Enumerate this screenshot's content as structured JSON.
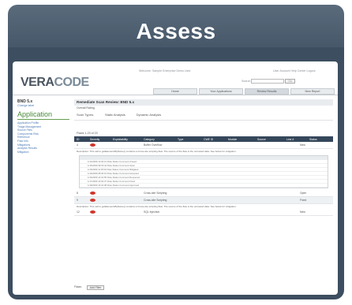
{
  "slide": {
    "title": "Assess"
  },
  "app": {
    "logo_a": "VERA",
    "logo_b": "CODE",
    "user_line": "Welcome: Sample Enterprise Demo User",
    "user_links": "User Account   Help Center   Logout",
    "search_label": "Search",
    "go_label": "Go",
    "nav_tabs": [
      "Home",
      "Your Applications",
      "Review Results",
      "New Report"
    ],
    "side": {
      "line1": "BND 5.x",
      "line2": "Change label",
      "heading": "Application",
      "links": [
        "Application Profile",
        "Triage Management",
        "Source Files",
        "Components Risk",
        "Reference",
        "Flaw Info",
        "Mitigations",
        "Analysis Results",
        "Mitigation"
      ]
    },
    "main": {
      "title": "Remediate Scan Review: BND 5.x",
      "overall": "Overall Rating",
      "filter_scan": "Scan Types:",
      "filter_static": "Static Analysis",
      "filter_dynamic": "Dynamic Analysis",
      "pager": "Flaws 1-23 of 23",
      "grid_cols": [
        "ID",
        "Severity",
        "Exploitability",
        "Category",
        "Type",
        "CWE ID",
        "Module",
        "Source",
        "Line #",
        "Status"
      ],
      "rows": [
        {
          "id": "4",
          "cat": "Buffer Overflow",
          "status": "New"
        },
        {
          "id": "8",
          "cat": "Cross-site Scripting",
          "status": "Open"
        },
        {
          "id": "9",
          "cat": "Cross-site Scripting",
          "status": "Fixed"
        },
        {
          "id": "12",
          "cat": "SQL Injection",
          "status": "New"
        }
      ],
      "desc": "Description: This call to getElementsByName() contains a Cross-site scripting flaw. The source of the flaw is the untrusted data. See below for mitigation.",
      "detail_lines": [
        "1/14/2009 12:02:13  Flaw Status  Comment  Closed",
        "1/15/2009 09:15:44  Flaw Status  Comment  Open",
        "1/15/2009 11:45:02  Flaw Status  Comment  Mitigated",
        "1/16/2009 08:30:19  Flaw Status  Comment  Accepted",
        "1/16/2009 14:10:55  Flaw Status  Comment  Reopened",
        "1/17/2009 10:02:37  Flaw Status  Comment  Fixed",
        "1/18/2009 16:22:08  Flaw Status  Comment  Approved"
      ],
      "bottom_label": "Flaws:",
      "bottom_button": "Add Filter"
    }
  }
}
